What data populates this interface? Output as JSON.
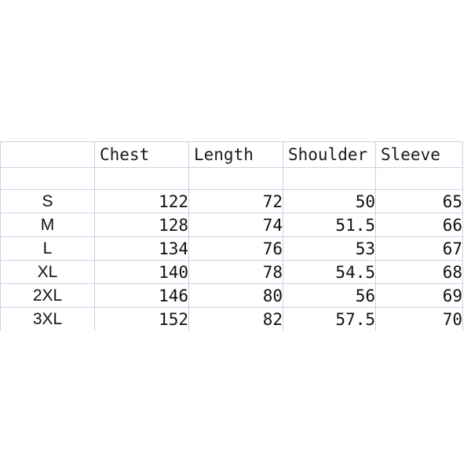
{
  "chart_data": {
    "type": "table",
    "title": "",
    "columns": [
      "",
      "Chest",
      "Length",
      "Shoulder",
      "Sleeve"
    ],
    "row_header_label": "",
    "categories": [
      "S",
      "M",
      "L",
      "XL",
      "2XL",
      "3XL"
    ],
    "series": [
      {
        "name": "Chest",
        "values": [
          "122",
          "128",
          "134",
          "140",
          "146",
          "152"
        ]
      },
      {
        "name": "Length",
        "values": [
          "72",
          "74",
          "76",
          "78",
          "80",
          "82"
        ]
      },
      {
        "name": "Shoulder",
        "values": [
          "50",
          "51.5",
          "53",
          "54.5",
          "56",
          "57.5"
        ]
      },
      {
        "name": "Sleeve",
        "values": [
          "65",
          "66",
          "67",
          "68",
          "69",
          "70"
        ]
      }
    ],
    "has_spacer_row": true,
    "grid": true
  },
  "table": {
    "corner_label": "",
    "headers": {
      "size": "",
      "chest": "Chest",
      "length": "Length",
      "shoulder": "Shoulder",
      "sleeve": "Sleeve"
    },
    "spacer": {
      "size": "",
      "chest": "",
      "length": "",
      "shoulder": "",
      "sleeve": ""
    },
    "rows": [
      {
        "size": "S",
        "chest": "122",
        "length": "72",
        "shoulder": "50",
        "sleeve": "65"
      },
      {
        "size": "M",
        "chest": "128",
        "length": "74",
        "shoulder": "51.5",
        "sleeve": "66"
      },
      {
        "size": "L",
        "chest": "134",
        "length": "76",
        "shoulder": "53",
        "sleeve": "67"
      },
      {
        "size": "XL",
        "chest": "140",
        "length": "78",
        "shoulder": "54.5",
        "sleeve": "68"
      },
      {
        "size": "2XL",
        "chest": "146",
        "length": "80",
        "shoulder": "56",
        "sleeve": "69"
      },
      {
        "size": "3XL",
        "chest": "152",
        "length": "82",
        "shoulder": "57.5",
        "sleeve": "70"
      }
    ]
  },
  "colors": {
    "background": "#ffffff",
    "gridline": "#ccd1e4",
    "text": "#111111"
  }
}
